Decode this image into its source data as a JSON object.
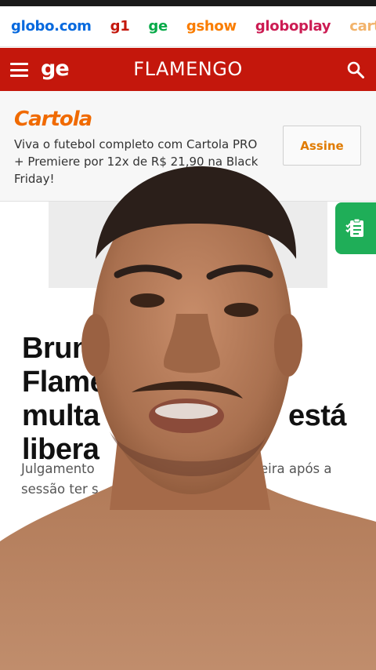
{
  "portal_links": [
    {
      "label": "globo.com",
      "color": "#0669de"
    },
    {
      "label": "g1",
      "color": "#c4170c"
    },
    {
      "label": "ge",
      "color": "#06aa48"
    },
    {
      "label": "gshow",
      "color": "#fa7d00"
    },
    {
      "label": "globoplay",
      "color": "#cc1c53"
    },
    {
      "label": "cartola",
      "color": "#f2b36b"
    }
  ],
  "header": {
    "logo": "ge",
    "title": "FLAMENGO",
    "bg_color": "#c4170c"
  },
  "promo": {
    "brand": "Cartola",
    "text": "Viva o futebol completo com Cartola PRO + Premiere por 12x de R$ 21,90 na Black Friday!",
    "button_label": "Assine"
  },
  "article": {
    "headline_lines": [
      "Brun",
      "Flame",
      "multa",
      "libera"
    ],
    "headline_fragment": "está",
    "subhead_line1_start": "Julgamento",
    "subhead_line1_end": "eira após a",
    "subhead_line2": "sessão ter s"
  },
  "icons": {
    "menu": "hamburger-menu-icon",
    "search": "search-icon",
    "float": "checklist-icon"
  }
}
